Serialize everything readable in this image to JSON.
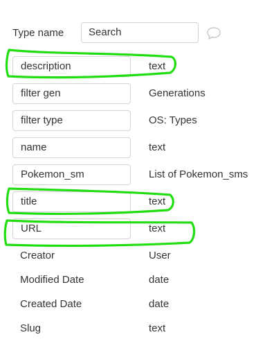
{
  "type_name": {
    "label": "Type name",
    "value": "Search"
  },
  "fields": [
    {
      "name": "description",
      "type": "text"
    },
    {
      "name": "filter gen",
      "type": "Generations"
    },
    {
      "name": "filter type",
      "type": "OS: Types"
    },
    {
      "name": "name",
      "type": "text"
    },
    {
      "name": "Pokemon_sm",
      "type": "List of Pokemon_sms"
    },
    {
      "name": "title",
      "type": "text"
    },
    {
      "name": "URL",
      "type": "text"
    }
  ],
  "builtin_fields": [
    {
      "name": "Creator",
      "type": "User"
    },
    {
      "name": "Modified Date",
      "type": "date"
    },
    {
      "name": "Created Date",
      "type": "date"
    },
    {
      "name": "Slug",
      "type": "text"
    }
  ],
  "colors": {
    "highlight": "#22dd11",
    "border": "#d3d3d3",
    "text": "#333333"
  },
  "icons": {
    "comment": "speech-bubble-icon"
  }
}
